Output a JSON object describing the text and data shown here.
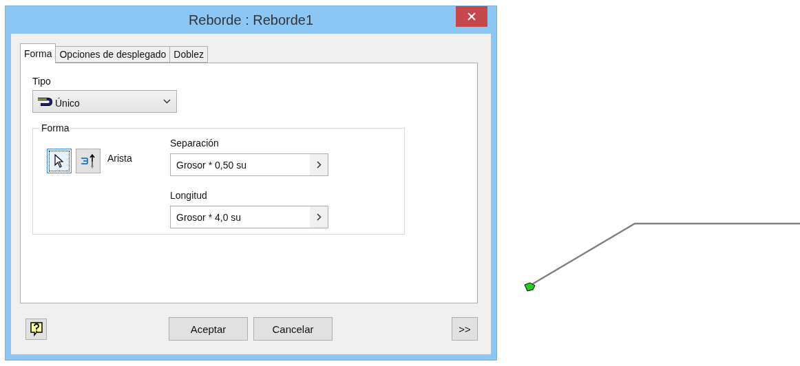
{
  "window": {
    "title": "Reborde : Reborde1"
  },
  "tabs": [
    {
      "label": "Forma",
      "selected": true
    },
    {
      "label": "Opciones de desplegado",
      "selected": false
    },
    {
      "label": "Doblez",
      "selected": false
    }
  ],
  "tipo": {
    "label": "Tipo",
    "value": "Único"
  },
  "group": {
    "legend": "Forma",
    "selection_tools": [
      {
        "kind": "pointer",
        "selected": true
      },
      {
        "kind": "edge-direction",
        "selected": false
      }
    ],
    "edge_label": "Arista",
    "fields": [
      {
        "label": "Separación",
        "value": "Grosor * 0,50 su"
      },
      {
        "label": "Longitud",
        "value": "Grosor * 4,0 su"
      }
    ]
  },
  "buttons": [
    "Aceptar",
    "Cancelar"
  ],
  "more_button": ">>"
}
